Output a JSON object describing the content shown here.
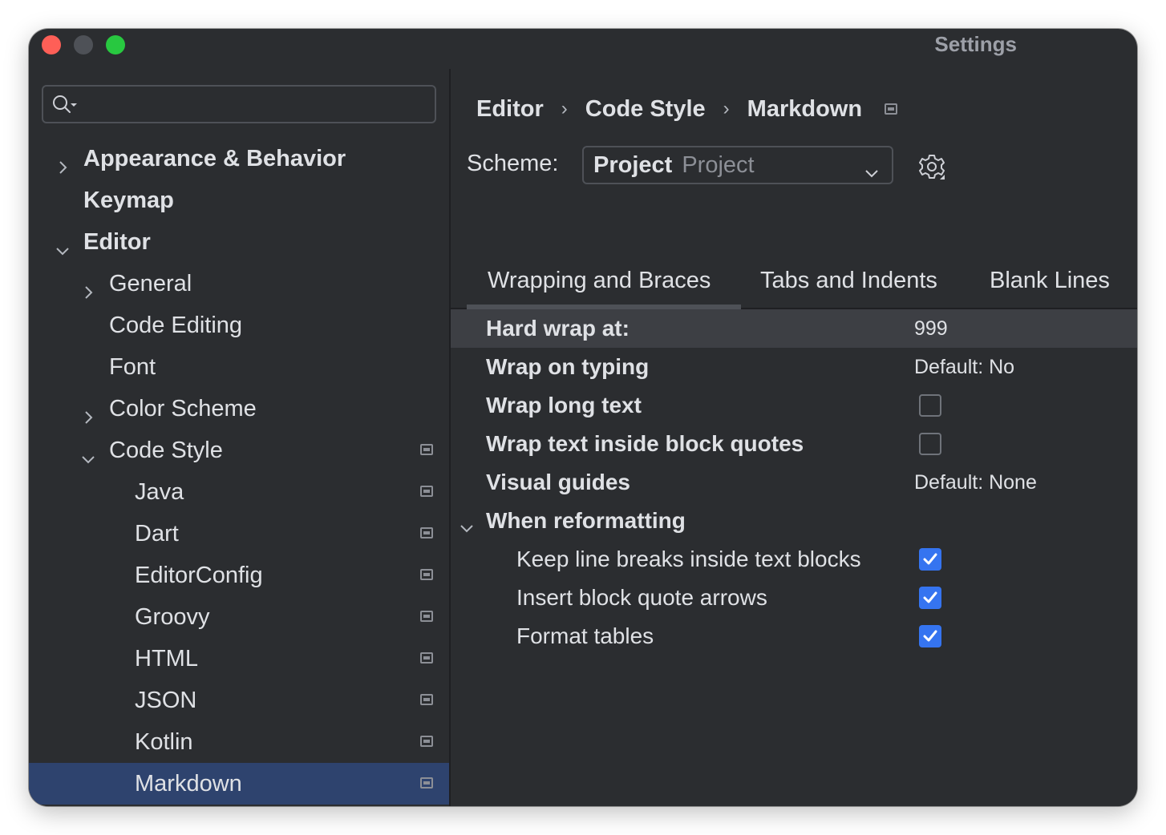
{
  "window": {
    "title": "Settings"
  },
  "search": {
    "value": "",
    "placeholder": ""
  },
  "sidebar": {
    "items": [
      {
        "label": "Appearance & Behavior",
        "expander": "chevron-right",
        "level": 0,
        "bold": true
      },
      {
        "label": "Keymap",
        "expander": null,
        "level": 0,
        "bold": true
      },
      {
        "label": "Editor",
        "expander": "chevron-down",
        "level": 0,
        "bold": true
      },
      {
        "label": "General",
        "expander": "chevron-right",
        "level": 1,
        "bold": false
      },
      {
        "label": "Code Editing",
        "expander": null,
        "level": 1,
        "bold": false
      },
      {
        "label": "Font",
        "expander": null,
        "level": 1,
        "bold": false
      },
      {
        "label": "Color Scheme",
        "expander": "chevron-right",
        "level": 1,
        "bold": false
      },
      {
        "label": "Code Style",
        "expander": "chevron-down",
        "level": 1,
        "bold": false,
        "project_icon": true
      },
      {
        "label": "Java",
        "expander": null,
        "level": 2,
        "bold": false,
        "project_icon": true
      },
      {
        "label": "Dart",
        "expander": null,
        "level": 2,
        "bold": false,
        "project_icon": true
      },
      {
        "label": "EditorConfig",
        "expander": null,
        "level": 2,
        "bold": false,
        "project_icon": true
      },
      {
        "label": "Groovy",
        "expander": null,
        "level": 2,
        "bold": false,
        "project_icon": true
      },
      {
        "label": "HTML",
        "expander": null,
        "level": 2,
        "bold": false,
        "project_icon": true
      },
      {
        "label": "JSON",
        "expander": null,
        "level": 2,
        "bold": false,
        "project_icon": true
      },
      {
        "label": "Kotlin",
        "expander": null,
        "level": 2,
        "bold": false,
        "project_icon": true
      },
      {
        "label": "Markdown",
        "expander": null,
        "level": 2,
        "bold": false,
        "project_icon": true,
        "selected": true
      }
    ]
  },
  "breadcrumb": {
    "items": [
      "Editor",
      "Code Style",
      "Markdown"
    ],
    "separator": "›"
  },
  "scheme": {
    "label": "Scheme:",
    "value": "Project",
    "hint": "Project"
  },
  "tabs": {
    "items": [
      "Wrapping and Braces",
      "Tabs and Indents",
      "Blank Lines"
    ],
    "active": "Wrapping and Braces"
  },
  "options": [
    {
      "label": "Hard wrap at:",
      "type": "value",
      "value": "999",
      "bold": true,
      "selected": true
    },
    {
      "label": "Wrap on typing",
      "type": "value",
      "value": "Default: No",
      "bold": true
    },
    {
      "label": "Wrap long text",
      "type": "checkbox",
      "checked": false,
      "bold": true
    },
    {
      "label": "Wrap text inside block quotes",
      "type": "checkbox",
      "checked": false,
      "bold": true
    },
    {
      "label": "Visual guides",
      "type": "value",
      "value": "Default: None",
      "bold": true
    },
    {
      "label": "When reformatting",
      "type": "group",
      "expanded": true,
      "bold": true
    },
    {
      "label": "Keep line breaks inside text blocks",
      "type": "checkbox",
      "checked": true,
      "sub": true
    },
    {
      "label": "Insert block quote arrows",
      "type": "checkbox",
      "checked": true,
      "sub": true
    },
    {
      "label": "Format tables",
      "type": "checkbox",
      "checked": true,
      "sub": true
    }
  ],
  "colors": {
    "background": "#2b2d30",
    "selection": "#2e436e",
    "accent": "#3574f0",
    "row_highlight": "#3d3f44"
  }
}
